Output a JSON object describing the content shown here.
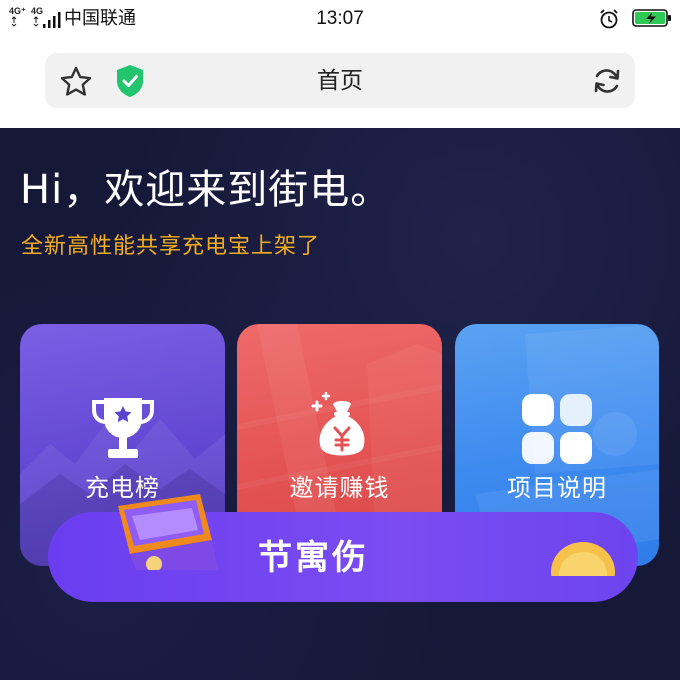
{
  "status_bar": {
    "network_1": "4G⁺",
    "network_2": "4G",
    "carrier": "中国联通",
    "time": "13:07",
    "icons": [
      "signal-icon",
      "alarm-icon",
      "battery-charging-icon"
    ]
  },
  "browser": {
    "page_title": "首页",
    "icons": [
      "star-icon",
      "secure-shield-icon",
      "refresh-icon"
    ]
  },
  "hero": {
    "greeting": "Hi，欢迎来到街电。",
    "subtitle": "全新高性能共享充电宝上架了"
  },
  "cards": [
    {
      "label": "充电榜",
      "icon": "trophy-icon",
      "color": "#6a4fdc"
    },
    {
      "label": "邀请赚钱",
      "icon": "money-bag-icon",
      "color": "#e45353"
    },
    {
      "label": "项目说明",
      "icon": "grid-icon",
      "color": "#3d8af0"
    }
  ],
  "banner": {
    "text": "节寓伤",
    "icons": [
      "treasure-chest-icon",
      "coin-icon"
    ]
  },
  "colors": {
    "background": "#161838",
    "subtitle": "#f4ad1f",
    "banner": "#6a3df0",
    "shield": "#22c46e",
    "battery": "#2fc957"
  }
}
